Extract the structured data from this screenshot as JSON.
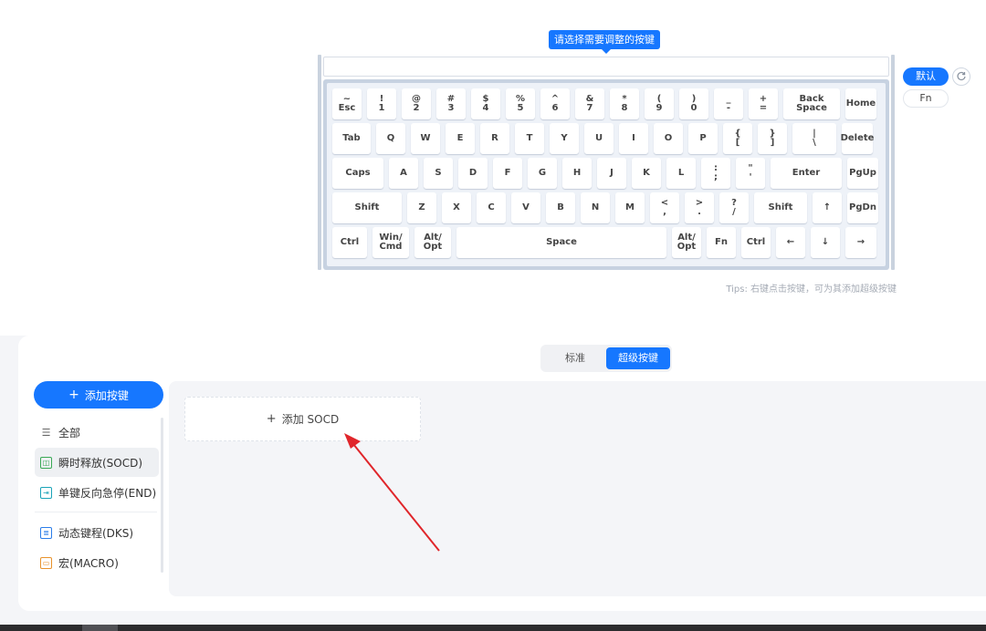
{
  "tooltip": "请选择需要调整的按键",
  "right_controls": {
    "default_label": "默认",
    "reset_icon": "reset-icon",
    "fn_label": "Fn"
  },
  "tips": "Tips: 右键点击按键，可为其添加超级按键",
  "keyboard": {
    "rows": [
      [
        {
          "t": "~",
          "b": "Esc"
        },
        {
          "t": "!",
          "b": "1"
        },
        {
          "t": "@",
          "b": "2"
        },
        {
          "t": "#",
          "b": "3"
        },
        {
          "t": "$",
          "b": "4"
        },
        {
          "t": "%",
          "b": "5"
        },
        {
          "t": "^",
          "b": "6"
        },
        {
          "t": "&",
          "b": "7"
        },
        {
          "t": "*",
          "b": "8"
        },
        {
          "t": "(",
          "b": "9"
        },
        {
          "t": ")",
          "b": "0"
        },
        {
          "t": "_",
          "b": "-"
        },
        {
          "t": "+",
          "b": "="
        },
        {
          "t": "",
          "b": "Back Space"
        },
        {
          "t": "",
          "b": "Home"
        }
      ],
      [
        {
          "t": "",
          "b": "Tab"
        },
        {
          "t": "",
          "b": "Q"
        },
        {
          "t": "",
          "b": "W"
        },
        {
          "t": "",
          "b": "E"
        },
        {
          "t": "",
          "b": "R"
        },
        {
          "t": "",
          "b": "T"
        },
        {
          "t": "",
          "b": "Y"
        },
        {
          "t": "",
          "b": "U"
        },
        {
          "t": "",
          "b": "I"
        },
        {
          "t": "",
          "b": "O"
        },
        {
          "t": "",
          "b": "P"
        },
        {
          "t": "{",
          "b": "["
        },
        {
          "t": "}",
          "b": "]"
        },
        {
          "t": "|",
          "b": "\\"
        },
        {
          "t": "",
          "b": "Delete"
        }
      ],
      [
        {
          "t": "",
          "b": "Caps"
        },
        {
          "t": "",
          "b": "A"
        },
        {
          "t": "",
          "b": "S"
        },
        {
          "t": "",
          "b": "D"
        },
        {
          "t": "",
          "b": "F"
        },
        {
          "t": "",
          "b": "G"
        },
        {
          "t": "",
          "b": "H"
        },
        {
          "t": "",
          "b": "J"
        },
        {
          "t": "",
          "b": "K"
        },
        {
          "t": "",
          "b": "L"
        },
        {
          "t": ":",
          "b": ";"
        },
        {
          "t": "\"",
          "b": "'"
        },
        {
          "t": "",
          "b": "Enter"
        },
        {
          "t": "",
          "b": "PgUp"
        }
      ],
      [
        {
          "t": "",
          "b": "Shift"
        },
        {
          "t": "",
          "b": "Z"
        },
        {
          "t": "",
          "b": "X"
        },
        {
          "t": "",
          "b": "C"
        },
        {
          "t": "",
          "b": "V"
        },
        {
          "t": "",
          "b": "B"
        },
        {
          "t": "",
          "b": "N"
        },
        {
          "t": "",
          "b": "M"
        },
        {
          "t": "<",
          "b": ","
        },
        {
          "t": ">",
          "b": "."
        },
        {
          "t": "?",
          "b": "/"
        },
        {
          "t": "",
          "b": "Shift"
        },
        {
          "t": "",
          "b": "↑"
        },
        {
          "t": "",
          "b": "PgDn"
        }
      ],
      [
        {
          "t": "",
          "b": "Ctrl"
        },
        {
          "t": "Win/",
          "b": "Cmd"
        },
        {
          "t": "Alt/",
          "b": "Opt"
        },
        {
          "t": "",
          "b": "Space"
        },
        {
          "t": "Alt/",
          "b": "Opt"
        },
        {
          "t": "",
          "b": "Fn"
        },
        {
          "t": "",
          "b": "Ctrl"
        },
        {
          "t": "",
          "b": "←"
        },
        {
          "t": "",
          "b": "↓"
        },
        {
          "t": "",
          "b": "→"
        }
      ]
    ]
  },
  "tabs": [
    {
      "label": "标准",
      "active": false
    },
    {
      "label": "超级按键",
      "active": true
    }
  ],
  "sidebar": {
    "add_button": "添加按键",
    "add_icon": "plus-icon",
    "items": [
      {
        "label": "全部",
        "icon": "list-icon"
      },
      {
        "label": "瞬时释放(SOCD)",
        "icon": "socd-icon",
        "active": true
      },
      {
        "label": "单键反向急停(END)",
        "icon": "end-icon"
      },
      {
        "label": "动态键程(DKS)",
        "icon": "dks-icon"
      },
      {
        "label": "宏(MACRO)",
        "icon": "macro-icon"
      }
    ]
  },
  "main": {
    "add_socd_label": "添加 SOCD",
    "add_icon": "plus-icon"
  },
  "colors": {
    "accent": "#1677ff",
    "arrow": "#e0262b",
    "keyboard_case": "#c7d2e1"
  }
}
